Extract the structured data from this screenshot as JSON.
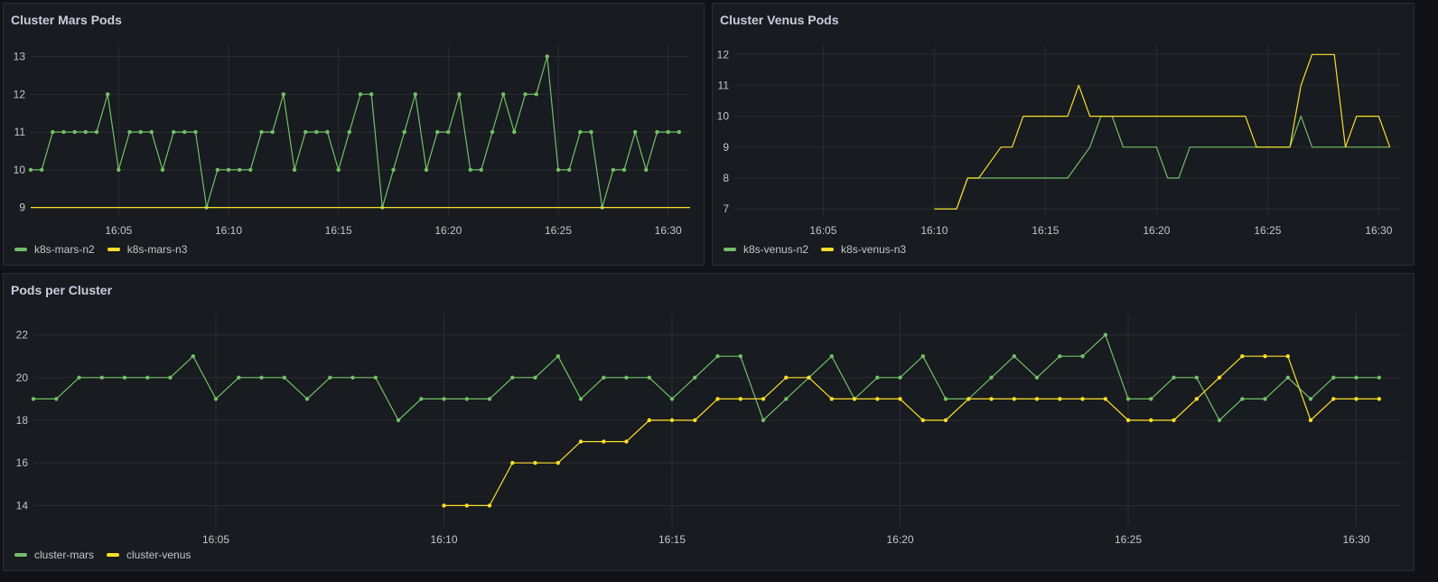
{
  "colors": {
    "green": "#73bf69",
    "yellow": "#fade2a",
    "grid": "#2a2d33",
    "tick_text": "#c4c6cc"
  },
  "panels": [
    {
      "title": "Cluster Mars Pods",
      "legend": [
        "k8s-mars-n2",
        "k8s-mars-n3"
      ]
    },
    {
      "title": "Cluster Venus Pods",
      "legend": [
        "k8s-venus-n2",
        "k8s-venus-n3"
      ]
    },
    {
      "title": "Pods per Cluster",
      "legend": [
        "cluster-mars",
        "cluster-venus"
      ]
    }
  ],
  "chart_data": [
    {
      "type": "line",
      "title": "Cluster Mars Pods",
      "xlabel": "",
      "ylabel": "",
      "x_range": [
        "16:01",
        "16:31"
      ],
      "x_ticks": [
        "16:05",
        "16:10",
        "16:15",
        "16:20",
        "16:25",
        "16:30"
      ],
      "ylim": [
        8.8,
        13.3
      ],
      "y_ticks": [
        9,
        10,
        11,
        12,
        13
      ],
      "grid": true,
      "legend_position": "bottom-left",
      "series": [
        {
          "name": "k8s-mars-n2",
          "color": "green",
          "points": true,
          "x": [
            "16:01:00",
            "16:01:30",
            "16:02:00",
            "16:02:30",
            "16:03:00",
            "16:03:30",
            "16:04:00",
            "16:04:30",
            "16:05:00",
            "16:05:30",
            "16:06:00",
            "16:06:30",
            "16:07:00",
            "16:07:30",
            "16:08:00",
            "16:08:30",
            "16:09:00",
            "16:09:30",
            "16:10:00",
            "16:10:30",
            "16:11:00",
            "16:11:30",
            "16:12:00",
            "16:12:30",
            "16:13:00",
            "16:13:30",
            "16:14:00",
            "16:14:30",
            "16:15:00",
            "16:15:30",
            "16:16:00",
            "16:16:30",
            "16:17:00",
            "16:17:30",
            "16:18:00",
            "16:18:30",
            "16:19:00",
            "16:19:30",
            "16:20:00",
            "16:20:30",
            "16:21:00",
            "16:21:30",
            "16:22:00",
            "16:22:30",
            "16:23:00",
            "16:23:30",
            "16:24:00",
            "16:24:30",
            "16:25:00",
            "16:25:30",
            "16:26:00",
            "16:26:30",
            "16:27:00",
            "16:27:30",
            "16:28:00",
            "16:28:30",
            "16:29:00",
            "16:29:30",
            "16:30:00",
            "16:30:30"
          ],
          "values": [
            10,
            10,
            11,
            11,
            11,
            11,
            11,
            12,
            10,
            11,
            11,
            11,
            10,
            11,
            11,
            11,
            9,
            10,
            10,
            10,
            10,
            11,
            11,
            12,
            10,
            11,
            11,
            11,
            10,
            11,
            12,
            12,
            9,
            10,
            11,
            12,
            10,
            11,
            11,
            12,
            10,
            10,
            11,
            12,
            11,
            12,
            12,
            13,
            10,
            10,
            11,
            11,
            9,
            10,
            10,
            11,
            10,
            11,
            11,
            11
          ]
        },
        {
          "name": "k8s-mars-n3",
          "color": "yellow",
          "points": false,
          "x": [
            "16:01:00",
            "16:31:00"
          ],
          "values": [
            9,
            9
          ]
        }
      ]
    },
    {
      "type": "line",
      "title": "Cluster Venus Pods",
      "xlabel": "",
      "ylabel": "",
      "x_range": [
        "16:01",
        "16:31"
      ],
      "x_ticks": [
        "16:05",
        "16:10",
        "16:15",
        "16:20",
        "16:25",
        "16:30"
      ],
      "ylim": [
        6.8,
        12.3
      ],
      "y_ticks": [
        7,
        8,
        9,
        10,
        11,
        12
      ],
      "grid": true,
      "legend_position": "bottom-left",
      "series": [
        {
          "name": "k8s-venus-n2",
          "color": "green",
          "points": false,
          "x": [
            "16:10:00",
            "16:11:00",
            "16:11:30",
            "16:12:00",
            "16:13:00",
            "16:14:00",
            "16:15:00",
            "16:16:00",
            "16:17:00",
            "16:17:30",
            "16:18:00",
            "16:18:30",
            "16:19:00",
            "16:20:00",
            "16:20:30",
            "16:21:00",
            "16:21:30",
            "16:22:00",
            "16:23:00",
            "16:24:00",
            "16:25:00",
            "16:26:00",
            "16:26:30",
            "16:27:00",
            "16:28:00",
            "16:29:00",
            "16:30:00",
            "16:30:30"
          ],
          "values": [
            7,
            7,
            8,
            8,
            8,
            8,
            8,
            8,
            9,
            10,
            10,
            9,
            9,
            9,
            8,
            8,
            9,
            9,
            9,
            9,
            9,
            9,
            10,
            9,
            9,
            9,
            9,
            9
          ]
        },
        {
          "name": "k8s-venus-n3",
          "color": "yellow",
          "points": false,
          "x": [
            "16:10:00",
            "16:11:00",
            "16:11:30",
            "16:12:00",
            "16:13:00",
            "16:13:30",
            "16:14:00",
            "16:14:30",
            "16:15:00",
            "16:16:00",
            "16:16:30",
            "16:17:00",
            "16:18:00",
            "16:19:00",
            "16:20:00",
            "16:21:00",
            "16:22:00",
            "16:23:00",
            "16:24:00",
            "16:24:30",
            "16:25:00",
            "16:26:00",
            "16:26:30",
            "16:27:00",
            "16:27:30",
            "16:28:00",
            "16:28:30",
            "16:29:00",
            "16:30:00",
            "16:30:30"
          ],
          "values": [
            7,
            7,
            8,
            8,
            9,
            9,
            10,
            10,
            10,
            10,
            11,
            10,
            10,
            10,
            10,
            10,
            10,
            10,
            10,
            9,
            9,
            9,
            11,
            12,
            12,
            12,
            9,
            10,
            10,
            9
          ]
        }
      ]
    },
    {
      "type": "line",
      "title": "Pods per Cluster",
      "xlabel": "",
      "ylabel": "",
      "x_range": [
        "16:01",
        "16:31"
      ],
      "x_ticks": [
        "16:05",
        "16:10",
        "16:15",
        "16:20",
        "16:25",
        "16:30"
      ],
      "ylim": [
        13,
        23
      ],
      "y_ticks": [
        14,
        16,
        18,
        20,
        22
      ],
      "grid": true,
      "legend_position": "bottom-left",
      "series": [
        {
          "name": "cluster-mars",
          "color": "green",
          "points": true,
          "x": [
            "16:01:00",
            "16:01:30",
            "16:02:00",
            "16:02:30",
            "16:03:00",
            "16:03:30",
            "16:04:00",
            "16:04:30",
            "16:05:00",
            "16:05:30",
            "16:06:00",
            "16:06:30",
            "16:07:00",
            "16:07:30",
            "16:08:00",
            "16:08:30",
            "16:09:00",
            "16:09:30",
            "16:10:00",
            "16:10:30",
            "16:11:00",
            "16:11:30",
            "16:12:00",
            "16:12:30",
            "16:13:00",
            "16:13:30",
            "16:14:00",
            "16:14:30",
            "16:15:00",
            "16:15:30",
            "16:16:00",
            "16:16:30",
            "16:17:00",
            "16:17:30",
            "16:18:00",
            "16:18:30",
            "16:19:00",
            "16:19:30",
            "16:20:00",
            "16:20:30",
            "16:21:00",
            "16:21:30",
            "16:22:00",
            "16:22:30",
            "16:23:00",
            "16:23:30",
            "16:24:00",
            "16:24:30",
            "16:25:00",
            "16:25:30",
            "16:26:00",
            "16:26:30",
            "16:27:00",
            "16:27:30",
            "16:28:00",
            "16:28:30",
            "16:29:00",
            "16:29:30",
            "16:30:00",
            "16:30:30"
          ],
          "values": [
            19,
            19,
            20,
            20,
            20,
            20,
            20,
            21,
            19,
            20,
            20,
            20,
            19,
            20,
            20,
            20,
            18,
            19,
            19,
            19,
            19,
            20,
            20,
            21,
            19,
            20,
            20,
            20,
            19,
            20,
            21,
            21,
            18,
            19,
            20,
            21,
            19,
            20,
            20,
            21,
            19,
            19,
            20,
            21,
            20,
            21,
            21,
            22,
            19,
            19,
            20,
            20,
            18,
            19,
            19,
            20,
            19,
            20,
            20,
            20
          ]
        },
        {
          "name": "cluster-venus",
          "color": "yellow",
          "points": true,
          "x": [
            "16:10:00",
            "16:10:30",
            "16:11:00",
            "16:11:30",
            "16:12:00",
            "16:12:30",
            "16:13:00",
            "16:13:30",
            "16:14:00",
            "16:14:30",
            "16:15:00",
            "16:15:30",
            "16:16:00",
            "16:16:30",
            "16:17:00",
            "16:17:30",
            "16:18:00",
            "16:18:30",
            "16:19:00",
            "16:19:30",
            "16:20:00",
            "16:20:30",
            "16:21:00",
            "16:21:30",
            "16:22:00",
            "16:22:30",
            "16:23:00",
            "16:23:30",
            "16:24:00",
            "16:24:30",
            "16:25:00",
            "16:25:30",
            "16:26:00",
            "16:26:30",
            "16:27:00",
            "16:27:30",
            "16:28:00",
            "16:28:30",
            "16:29:00",
            "16:29:30",
            "16:30:00",
            "16:30:30"
          ],
          "values": [
            14,
            14,
            14,
            16,
            16,
            16,
            17,
            17,
            17,
            18,
            18,
            18,
            19,
            19,
            19,
            20,
            20,
            19,
            19,
            19,
            19,
            18,
            18,
            19,
            19,
            19,
            19,
            19,
            19,
            19,
            18,
            18,
            18,
            19,
            20,
            21,
            21,
            21,
            18,
            19,
            19,
            19
          ]
        }
      ]
    }
  ]
}
